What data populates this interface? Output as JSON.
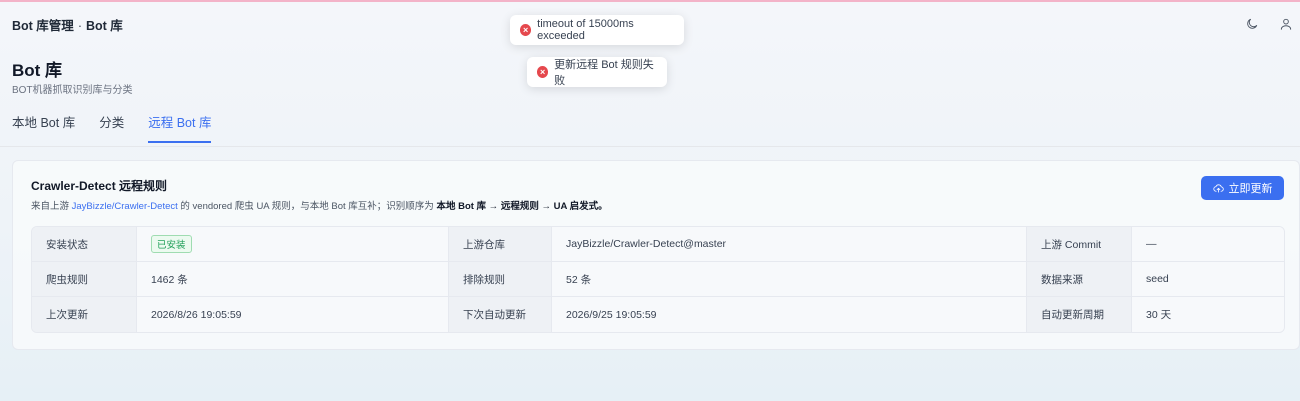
{
  "breadcrumb": {
    "section": "Bot 库管理",
    "separator": "·",
    "page": "Bot 库"
  },
  "header_icons": [
    "moon-icon",
    "user-icon"
  ],
  "toasts": [
    {
      "type": "error",
      "message": "timeout of 15000ms exceeded"
    },
    {
      "type": "error",
      "message": "更新远程 Bot 规则失败"
    }
  ],
  "page": {
    "title": "Bot 库",
    "subtitle": "BOT机器抓取识别库与分类"
  },
  "tabs": [
    {
      "label": "本地 Bot 库",
      "active": false
    },
    {
      "label": "分类",
      "active": false
    },
    {
      "label": "远程 Bot 库",
      "active": true
    }
  ],
  "card": {
    "title": "Crawler-Detect 远程规则",
    "desc_prefix": "来自上游 ",
    "desc_link": "JayBizzle/Crawler-Detect",
    "desc_mid": " 的 vendored 爬虫 UA 规则，与本地 Bot 库互补；识别顺序为 ",
    "desc_bold": "本地 Bot 库 → 远程规则 → UA 启发式。",
    "update_button": "立即更新"
  },
  "info": {
    "install_status_label": "安装状态",
    "install_status_value": "已安装",
    "upstream_repo_label": "上游仓库",
    "upstream_repo_value": "JayBizzle/Crawler-Detect@master",
    "upstream_commit_label": "上游 Commit",
    "upstream_commit_value": "—",
    "crawler_rules_label": "爬虫规则",
    "crawler_rules_value": "1462 条",
    "exclude_rules_label": "排除规则",
    "exclude_rules_value": "52 条",
    "data_source_label": "数据来源",
    "data_source_value": "seed",
    "last_update_label": "上次更新",
    "last_update_value": "2026/8/26 19:05:59",
    "next_update_label": "下次自动更新",
    "next_update_value": "2026/9/25 19:05:59",
    "auto_period_label": "自动更新周期",
    "auto_period_value": "30 天"
  },
  "colors": {
    "accent": "#3b6ff0",
    "error": "#e5484d",
    "success": "#22a05a"
  }
}
